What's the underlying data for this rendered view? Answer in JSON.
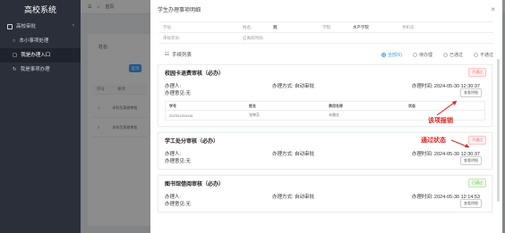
{
  "sidebar": {
    "title": "高校系统",
    "items": [
      {
        "label": "高校审批"
      },
      {
        "label": "本小事项处理"
      },
      {
        "label": "我是办理入口"
      },
      {
        "label": "我是事项办理"
      }
    ]
  },
  "bg": {
    "topbar_label": "首页",
    "field_label": "姓名:",
    "search_btn": "查询",
    "col1": "序号",
    "col2": "事项",
    "rows": [
      {
        "num": "1",
        "text": "本科生离校审批"
      },
      {
        "num": "2",
        "text": "本科生离校审批"
      }
    ]
  },
  "dialog": {
    "title": "学生办理事项明细",
    "close": "×",
    "info": {
      "row1": {
        "l1": "学号:",
        "v1": "",
        "l2": "姓名:",
        "v2": "魏",
        "l3": "学院:",
        "v3": "水产学院",
        "l4": "手机号:",
        "v4": ""
      },
      "row2": {
        "l1": "审核年份:",
        "v1": "",
        "l2": "应离校时间:",
        "v2": "",
        "l3": "",
        "v3": "",
        "l4": "",
        "v4": ""
      }
    },
    "list_title": "手续列表",
    "filters": [
      "全部(6)",
      "待办理",
      "已通过",
      "不通过"
    ]
  },
  "items": [
    {
      "title": "校园卡退费审核（必办）",
      "status": "不通过",
      "handler_label": "办理人:",
      "handler": "",
      "method_label": "办理方式: 自动审批",
      "time_label": "办理时间:",
      "time": "2024-05-30 12:30:37",
      "note_label": "办理意见:",
      "note": "无",
      "detail_btn": "查看明细",
      "table": {
        "headers": [
          "学号",
          "姓名",
          "费用名称",
          "状态"
        ],
        "row": [
          "202301154416",
          "张晓芳",
          "未缴交",
          ""
        ]
      }
    },
    {
      "title": "学工处分审核（必办）",
      "status": "不通过",
      "handler_label": "办理人:",
      "handler": "",
      "method_label": "办理方式: 自动审批",
      "time_label": "办理时间:",
      "time": "2024-05-30 12:30:37",
      "note_label": "办理意见:",
      "note": "无",
      "detail_btn": "查看明细"
    },
    {
      "title": "图书馆借阅审核（必办）",
      "status": "已通过",
      "handler_label": "办理人:",
      "handler": "",
      "method_label": "办理方式: 自动审批",
      "time_label": "办理时间:",
      "time": "2024-05-30 12:14:53",
      "note_label": "办理意见:",
      "note": "无",
      "detail_btn": "查看明细"
    }
  ],
  "annotations": {
    "a1": "该项报销",
    "a2": "通过状态"
  },
  "colors": {
    "accent": "#409eff",
    "red": "#f56c6c",
    "green": "#67c23a",
    "annot": "#e02020"
  }
}
